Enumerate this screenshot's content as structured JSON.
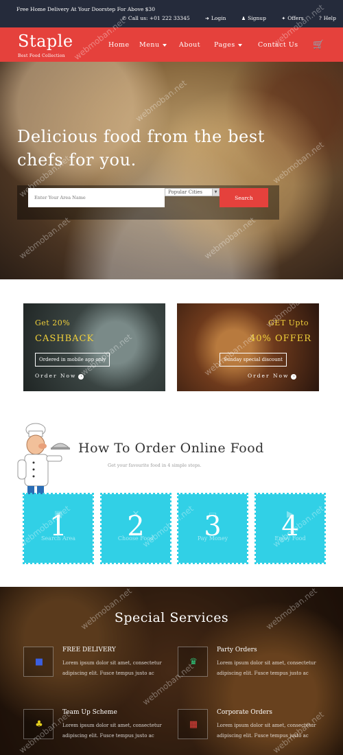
{
  "topbar": {
    "promo": "Free Home Delivery At Your Doorstep For Above $30",
    "call": "Call us: +01 222 33345",
    "login": "Login",
    "signup": "Signup",
    "offers": "Offers",
    "help": "Help"
  },
  "nav": {
    "logo": "Staple",
    "tagline": "Best Food Collection",
    "items": [
      "Home",
      "Menu",
      "About",
      "Pages",
      "Contact Us"
    ]
  },
  "hero": {
    "heading": "Delicious food from the best chefs for you.",
    "search_placeholder": "Enter Your Area Name",
    "city_default": "Popular Cities",
    "search_button": "Search"
  },
  "offers": [
    {
      "pre": "Get 20%",
      "big": "CASHBACK",
      "tag": "Ordered in mobile app only",
      "cta": "Order Now"
    },
    {
      "pre": "GET Upto",
      "big": "40% OFFER",
      "tag": "Sunday special discount",
      "cta": "Order Now"
    }
  ],
  "how": {
    "title": "How To Order Online Food",
    "subtitle": "Get your favourite food in 4 simple steps.",
    "steps": [
      {
        "num": "1",
        "label": "Search Area"
      },
      {
        "num": "2",
        "label": "Choose Food"
      },
      {
        "num": "3",
        "label": "Pay Money"
      },
      {
        "num": "4",
        "label": "Enjoy Food"
      }
    ]
  },
  "services": {
    "title": "Special Services",
    "items": [
      {
        "name": "FREE DELIVERY",
        "desc": "Lorem ipsum dolor sit amet, consectetur adipiscing elit. Fusce tempus justo ac",
        "color": "#3b5fe0",
        "icon": "truck-icon"
      },
      {
        "name": "Party Orders",
        "desc": "Lorem ipsum dolor sit amet, consectetur adipiscing elit. Fusce tempus justo ac",
        "color": "#2ec47a",
        "icon": "cake-icon"
      },
      {
        "name": "Team Up Scheme",
        "desc": "Lorem ipsum dolor sit amet, consectetur adipiscing elit. Fusce tempus justo ac",
        "color": "#e6d11e",
        "icon": "users-icon"
      },
      {
        "name": "Corporate Orders",
        "desc": "Lorem ipsum dolor sit amet, consectetur adipiscing elit. Fusce tempus justo ac",
        "color": "#e5413c",
        "icon": "building-icon"
      }
    ]
  },
  "watermark": "webmoban.net",
  "colors": {
    "brand_red": "#e5413c",
    "dark_bar": "#252b3b",
    "step_cyan": "#31d0e6",
    "offer_yellow": "#f2d13a"
  }
}
